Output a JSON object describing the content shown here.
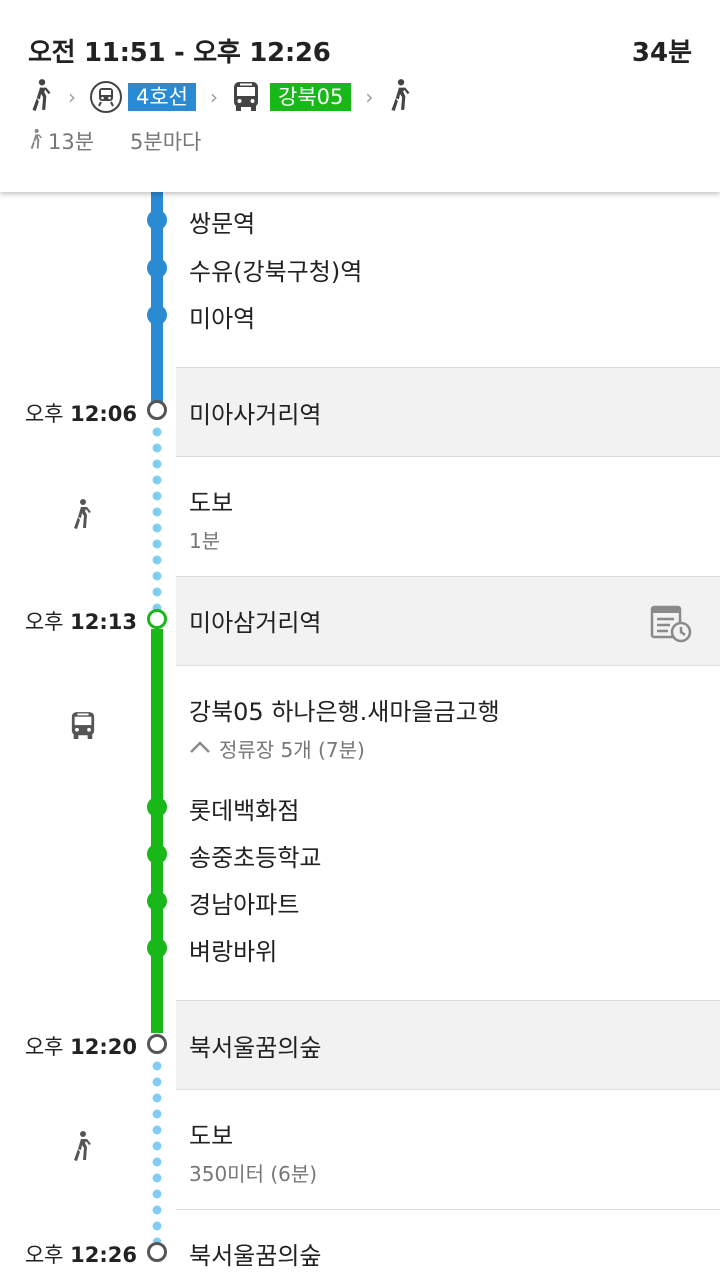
{
  "header": {
    "time_range": "오전 11:51 - 오후 12:26",
    "duration": "34분",
    "subway_line": "4호선",
    "bus_line": "강북05",
    "walk_total": "13분",
    "frequency": "5분마다",
    "colors": {
      "subway": "#2a8bd4",
      "bus": "#19b819"
    }
  },
  "subway_stops": [
    "쌍문역",
    "수유(강북구청)역",
    "미아역"
  ],
  "transfer1": {
    "time_prefix": "오후",
    "time": "12:06",
    "name": "미아사거리역"
  },
  "walk1": {
    "title": "도보",
    "detail": "1분"
  },
  "board": {
    "time_prefix": "오후",
    "time": "12:13",
    "name": "미아삼거리역",
    "schedule_icon": "schedule-clock-icon"
  },
  "bus_segment": {
    "title": "강북05 하나은행.새마을금고행",
    "stops_summary": "정류장 5개 (7분)"
  },
  "bus_stops": [
    "롯데백화점",
    "송중초등학교",
    "경남아파트",
    "벼랑바위"
  ],
  "alight": {
    "time_prefix": "오후",
    "time": "12:20",
    "name": "북서울꿈의숲"
  },
  "walk2": {
    "title": "도보",
    "detail": "350미터 (6분)"
  },
  "destination": {
    "time_prefix": "오후",
    "time": "12:26",
    "name": "북서울꿈의숲"
  }
}
